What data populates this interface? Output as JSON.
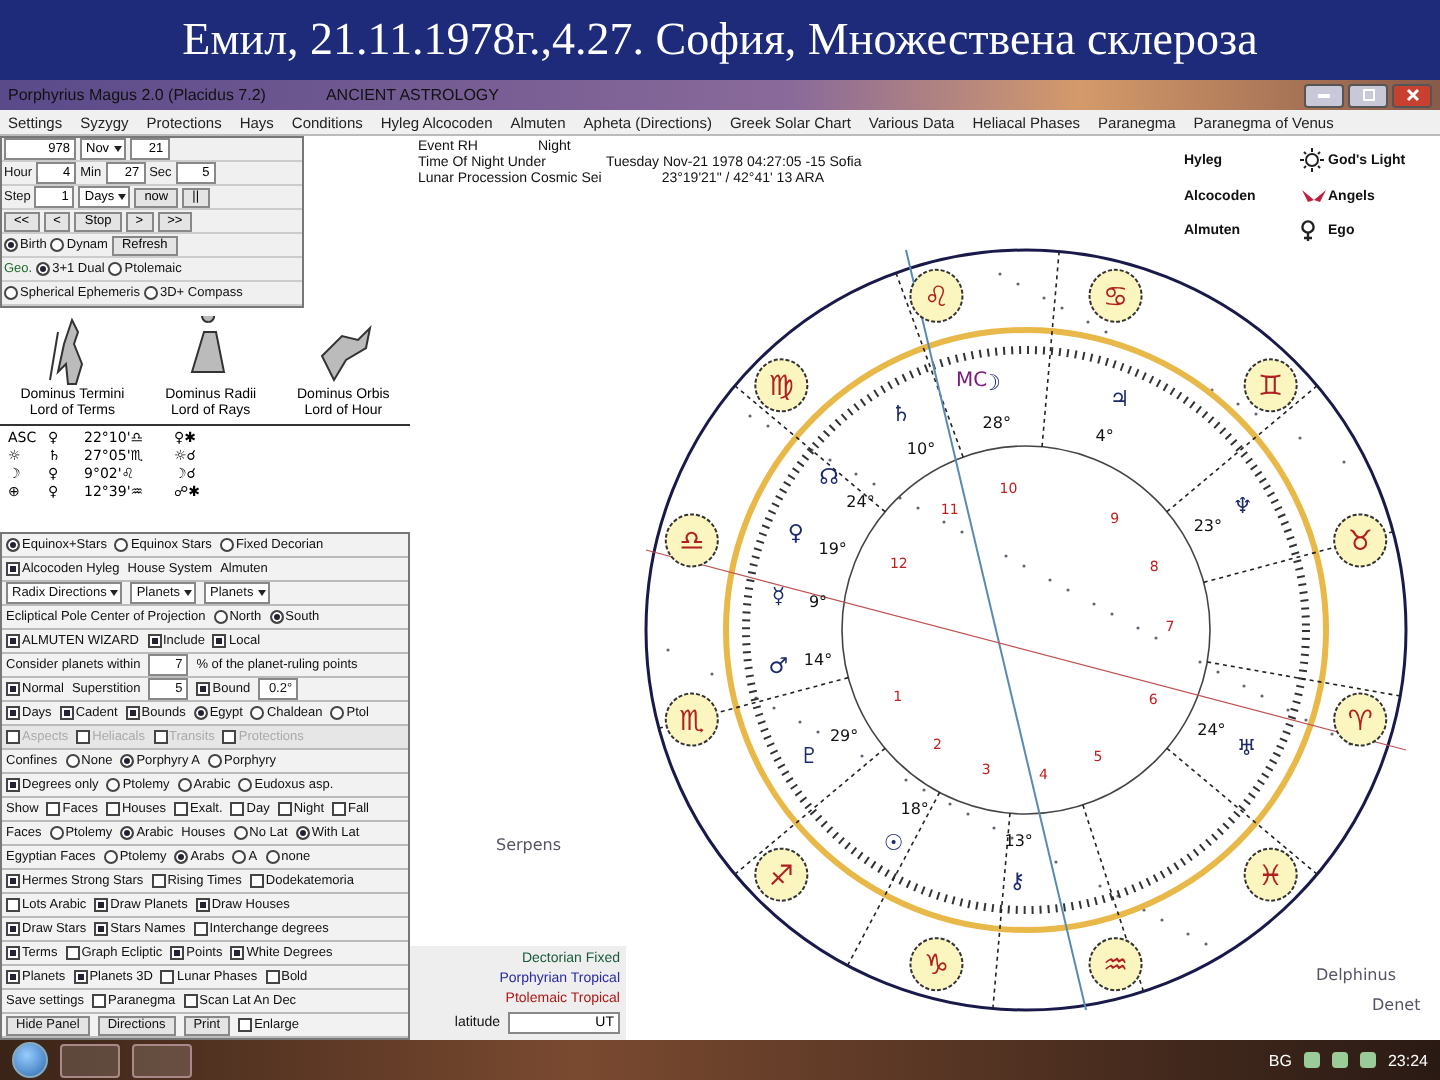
{
  "slide_title": "Емил, 21.11.1978г.,4.27. София, Множествена склероза",
  "window": {
    "title": "Porphyrius Magus 2.0 (Placidus 7.2)",
    "subtitle": "ANCIENT ASTROLOGY"
  },
  "menu": [
    "Settings",
    "Syzygy",
    "Protections",
    "Hays",
    "Conditions",
    "Hyleg Alcocoden",
    "Almuten",
    "Apheta (Directions)",
    "Greek Solar Chart",
    "Various Data",
    "Heliacal Phases",
    "Paranegma",
    "Paranegma of Venus"
  ],
  "controls": {
    "year": "978",
    "month": "Nov",
    "day": "21",
    "time": [
      {
        "label": "Hour",
        "value": "4"
      },
      {
        "label": "Min",
        "value": "27"
      },
      {
        "label": "Sec",
        "value": "5"
      }
    ],
    "step_label": "Step",
    "step_value": "1",
    "step_unit": "Days",
    "step_buttons": [
      "now",
      "||"
    ],
    "nav": [
      "<<",
      "<",
      "Stop",
      ">",
      ">>"
    ],
    "mode": [
      {
        "label": "Birth",
        "selected": true
      },
      {
        "label": "Dynam",
        "selected": false
      }
    ],
    "refresh": "Refresh",
    "geo_label": "Geo.",
    "geo": [
      {
        "label": "3+1 Dual",
        "selected": true
      },
      {
        "label": "Ptolemaic",
        "selected": false
      },
      {
        "label": "Spherical Ephemeris",
        "selected": false
      },
      {
        "label": "3D+ Compass",
        "selected": false
      }
    ]
  },
  "figures": [
    {
      "title": "Dominus Termini",
      "subtitle": "Lord of Terms"
    },
    {
      "title": "Dominus Radii",
      "subtitle": "Lord of Rays"
    },
    {
      "title": "Dominus Orbis",
      "subtitle": "Lord of Hour"
    }
  ],
  "rulers": [
    {
      "point": "ASC",
      "ruler": "♀",
      "position": "22°10'♎",
      "aspect": "♀✱"
    },
    {
      "point": "☼",
      "ruler": "♄",
      "position": "27°05'♏",
      "aspect": "☼☌"
    },
    {
      "point": "☽",
      "ruler": "♀",
      "position": "9°02'♌",
      "aspect": "☽☌"
    },
    {
      "point": "⊕",
      "ruler": "♀",
      "position": "12°39'♒",
      "aspect": "☍✱"
    }
  ],
  "options": [
    {
      "disabled": false,
      "items": [
        {
          "kind": "radio",
          "label": "Equinox+Stars",
          "checked": true
        },
        {
          "kind": "radio",
          "label": "Equinox Stars",
          "checked": false
        },
        {
          "kind": "radio",
          "label": "Fixed Decorian",
          "checked": false
        }
      ]
    },
    {
      "disabled": false,
      "items": [
        {
          "kind": "checkbox",
          "label": "Alcocoden Hyleg",
          "checked": true
        },
        {
          "kind": "text",
          "label": "House System"
        },
        {
          "kind": "text",
          "label": "Almuten"
        }
      ]
    },
    {
      "disabled": false,
      "items": [
        {
          "kind": "select",
          "label": "Radix Directions"
        },
        {
          "kind": "select",
          "label": "Planets"
        },
        {
          "kind": "select",
          "label": "Planets"
        }
      ]
    },
    {
      "disabled": false,
      "items": [
        {
          "kind": "text",
          "label": "Ecliptical Pole Center of Projection"
        },
        {
          "kind": "radio",
          "label": "North",
          "checked": false
        },
        {
          "kind": "radio",
          "label": "South",
          "checked": true
        }
      ]
    },
    {
      "disabled": false,
      "items": [
        {
          "kind": "checkbox",
          "label": "ALMUTEN WIZARD",
          "checked": true
        },
        {
          "kind": "checkbox",
          "label": "Include",
          "checked": true
        },
        {
          "kind": "checkbox",
          "label": "Local",
          "checked": true
        }
      ]
    },
    {
      "disabled": false,
      "items": [
        {
          "kind": "text",
          "label": "Consider planets within"
        },
        {
          "kind": "field",
          "label": "7"
        },
        {
          "kind": "text",
          "label": "% of the planet-ruling points"
        }
      ]
    },
    {
      "disabled": false,
      "items": [
        {
          "kind": "checkbox",
          "label": "Normal",
          "checked": true
        },
        {
          "kind": "text",
          "label": "Superstition"
        },
        {
          "kind": "field",
          "label": "5"
        },
        {
          "kind": "checkbox",
          "label": "Bound",
          "checked": true
        },
        {
          "kind": "field",
          "label": "0.2°"
        }
      ]
    },
    {
      "disabled": false,
      "items": [
        {
          "kind": "checkbox",
          "label": "Days",
          "checked": true
        },
        {
          "kind": "checkbox",
          "label": "Cadent",
          "checked": true
        },
        {
          "kind": "checkbox",
          "label": "Bounds",
          "checked": true
        },
        {
          "kind": "radio",
          "label": "Egypt",
          "checked": true
        },
        {
          "kind": "radio",
          "label": "Chaldean",
          "checked": false
        },
        {
          "kind": "radio",
          "label": "Ptol",
          "checked": false
        }
      ]
    },
    {
      "disabled": true,
      "items": [
        {
          "kind": "checkbox",
          "label": "Aspects",
          "checked": false
        },
        {
          "kind": "checkbox",
          "label": "Heliacals",
          "checked": false
        },
        {
          "kind": "checkbox",
          "label": "Transits",
          "checked": false
        },
        {
          "kind": "checkbox",
          "label": "Protections",
          "checked": false
        }
      ]
    },
    {
      "disabled": false,
      "items": [
        {
          "kind": "text",
          "label": "Confines"
        },
        {
          "kind": "radio",
          "label": "None",
          "checked": false
        },
        {
          "kind": "radio",
          "label": "Porphyry A",
          "checked": true
        },
        {
          "kind": "radio",
          "label": "Porphyry",
          "checked": false
        }
      ]
    },
    {
      "disabled": false,
      "items": [
        {
          "kind": "checkbox",
          "label": "Degrees only",
          "checked": true
        },
        {
          "kind": "radio",
          "label": "Ptolemy",
          "checked": false
        },
        {
          "kind": "radio",
          "label": "Arabic",
          "checked": false
        },
        {
          "kind": "radio",
          "label": "Eudoxus asp.",
          "checked": false
        }
      ]
    },
    {
      "disabled": false,
      "items": [
        {
          "kind": "text",
          "label": "Show"
        },
        {
          "kind": "checkbox",
          "label": "Faces",
          "checked": false
        },
        {
          "kind": "checkbox",
          "label": "Houses",
          "checked": false
        },
        {
          "kind": "checkbox",
          "label": "Exalt.",
          "checked": false
        },
        {
          "kind": "checkbox",
          "label": "Day",
          "checked": false
        },
        {
          "kind": "checkbox",
          "label": "Night",
          "checked": false
        },
        {
          "kind": "checkbox",
          "label": "Fall",
          "checked": false
        }
      ]
    },
    {
      "disabled": false,
      "items": [
        {
          "kind": "text",
          "label": "Faces"
        },
        {
          "kind": "radio",
          "label": "Ptolemy",
          "checked": false
        },
        {
          "kind": "radio",
          "label": "Arabic",
          "checked": true
        },
        {
          "kind": "text",
          "label": "Houses"
        },
        {
          "kind": "radio",
          "label": "No Lat",
          "checked": false
        },
        {
          "kind": "radio",
          "label": "With Lat",
          "checked": true
        }
      ]
    },
    {
      "disabled": false,
      "items": [
        {
          "kind": "text",
          "label": "Egyptian Faces"
        },
        {
          "kind": "radio",
          "label": "Ptolemy",
          "checked": false
        },
        {
          "kind": "radio",
          "label": "Arabs",
          "checked": true
        },
        {
          "kind": "radio",
          "label": "A",
          "checked": false
        },
        {
          "kind": "radio",
          "label": "none",
          "checked": false
        }
      ]
    },
    {
      "disabled": false,
      "items": [
        {
          "kind": "checkbox",
          "label": "Hermes Strong Stars",
          "checked": true
        },
        {
          "kind": "checkbox",
          "label": "Rising Times",
          "checked": false
        },
        {
          "kind": "checkbox",
          "label": "Dodekatemoria",
          "checked": false
        }
      ]
    },
    {
      "disabled": false,
      "items": [
        {
          "kind": "checkbox",
          "label": "Lots Arabic",
          "checked": false
        },
        {
          "kind": "checkbox",
          "label": "Draw Planets",
          "checked": true
        },
        {
          "kind": "checkbox",
          "label": "Draw Houses",
          "checked": true
        }
      ]
    },
    {
      "disabled": false,
      "items": [
        {
          "kind": "checkbox",
          "label": "Draw Stars",
          "checked": true
        },
        {
          "kind": "checkbox",
          "label": "Stars Names",
          "checked": true
        },
        {
          "kind": "checkbox",
          "label": "Interchange degrees",
          "checked": false
        }
      ]
    },
    {
      "disabled": false,
      "items": [
        {
          "kind": "checkbox",
          "label": "Terms",
          "checked": true
        },
        {
          "kind": "checkbox",
          "label": "Graph Ecliptic",
          "checked": false
        },
        {
          "kind": "checkbox",
          "label": "Points",
          "checked": true
        },
        {
          "kind": "checkbox",
          "label": "White Degrees",
          "checked": true
        }
      ]
    },
    {
      "disabled": false,
      "items": [
        {
          "kind": "checkbox",
          "label": "Planets",
          "checked": true
        },
        {
          "kind": "checkbox",
          "label": "Planets 3D",
          "checked": true
        },
        {
          "kind": "checkbox",
          "label": "Lunar Phases",
          "checked": false
        },
        {
          "kind": "checkbox",
          "label": "Bold",
          "checked": false
        }
      ]
    },
    {
      "disabled": false,
      "items": [
        {
          "kind": "text",
          "label": "Save settings"
        },
        {
          "kind": "checkbox",
          "label": "Paranegma",
          "checked": false
        },
        {
          "kind": "checkbox",
          "label": "Scan Lat An Dec",
          "checked": false
        }
      ]
    },
    {
      "disabled": false,
      "items": [
        {
          "kind": "button",
          "label": "Hide Panel"
        },
        {
          "kind": "button",
          "label": "Directions"
        },
        {
          "kind": "button",
          "label": "Print"
        },
        {
          "kind": "checkbox",
          "label": "Enlarge",
          "checked": false
        }
      ]
    }
  ],
  "info": [
    {
      "label": "Event RH",
      "value": "Night"
    },
    {
      "label": "Time Of Night Under",
      "value": "Tuesday Nov-21 1978 04:27:05 -15 Sofia"
    },
    {
      "label": "Lunar Procession Cosmic Sei",
      "value": "23°19'21\" / 42°41' 13 ARA"
    }
  ],
  "legend": [
    "Hyleg",
    "God's Light",
    "Alcocoden",
    "Angels",
    "Almuten",
    "Ego"
  ],
  "signs": [
    "♎",
    "♍",
    "♌",
    "♋",
    "♊",
    "♉",
    "♈",
    "♓",
    "♒",
    "♑",
    "♐",
    "♏"
  ],
  "planets": [
    {
      "glyph": "☽",
      "degree": "28°"
    },
    {
      "glyph": "♃",
      "degree": "4°"
    },
    {
      "glyph": "♄",
      "degree": "10°"
    },
    {
      "glyph": "☊",
      "degree": "24°"
    },
    {
      "glyph": "♆",
      "degree": "23°"
    },
    {
      "glyph": "♀",
      "degree": "19°"
    },
    {
      "glyph": "☿",
      "degree": "9°"
    },
    {
      "glyph": "♂",
      "degree": "14°"
    },
    {
      "glyph": "♇",
      "degree": "29°"
    },
    {
      "glyph": "☉",
      "degree": "18°"
    },
    {
      "glyph": "⚷",
      "degree": "13°"
    },
    {
      "glyph": "♅",
      "degree": "24°"
    }
  ],
  "mc_label": "MC",
  "houses": [
    "1",
    "2",
    "3",
    "4",
    "5",
    "6",
    "7",
    "8",
    "9",
    "10",
    "11",
    "12"
  ],
  "constellations": [
    "Delphinus",
    "Denet",
    "Serpens"
  ],
  "zodiac_panel": [
    {
      "label": "Dectorian Fixed",
      "color": "#1a5a3a"
    },
    {
      "label": "Porphyrian Tropical",
      "color": "#2a2aa0"
    },
    {
      "label": "Ptolemaic Tropical",
      "color": "#b01818"
    }
  ],
  "latitude": {
    "label": "latitude",
    "value": "UT"
  },
  "taskbar": {
    "language": "BG",
    "time": "23:24"
  }
}
